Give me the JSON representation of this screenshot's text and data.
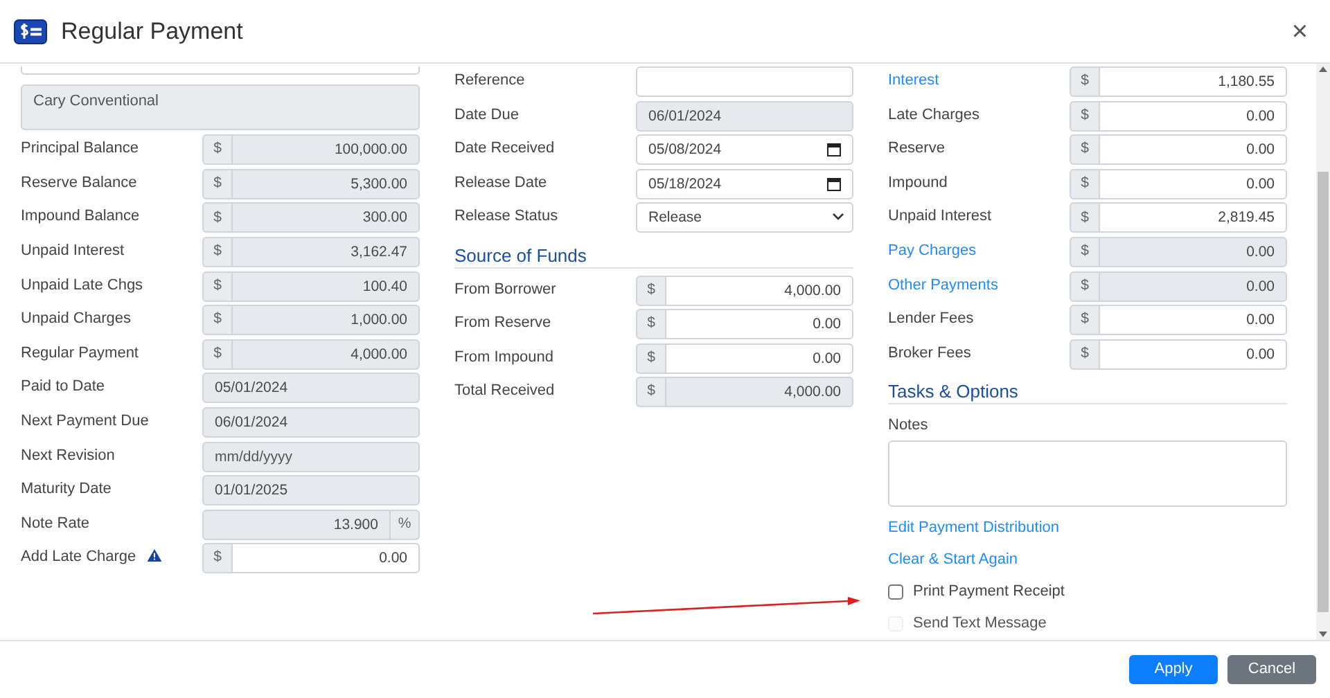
{
  "window": {
    "title": "Regular Payment",
    "close": "×"
  },
  "left": {
    "memo": "Cary Conventional",
    "fields": [
      {
        "label": "Principal Balance",
        "kind": "money",
        "unit": "$",
        "value": "100,000.00",
        "readonly": true
      },
      {
        "label": "Reserve Balance",
        "kind": "money",
        "unit": "$",
        "value": "5,300.00",
        "readonly": true
      },
      {
        "label": "Impound Balance",
        "kind": "money",
        "unit": "$",
        "value": "300.00",
        "readonly": true
      },
      {
        "label": "Unpaid Interest",
        "kind": "money",
        "unit": "$",
        "value": "3,162.47",
        "readonly": true
      },
      {
        "label": "Unpaid Late Chgs",
        "kind": "money",
        "unit": "$",
        "value": "100.40",
        "readonly": true
      },
      {
        "label": "Unpaid Charges",
        "kind": "money",
        "unit": "$",
        "value": "1,000.00",
        "readonly": true
      },
      {
        "label": "Regular Payment",
        "kind": "money",
        "unit": "$",
        "value": "4,000.00",
        "readonly": true
      },
      {
        "label": "Paid to Date",
        "kind": "date",
        "value": "05/01/2024",
        "readonly": true
      },
      {
        "label": "Next Payment Due",
        "kind": "date",
        "value": "06/01/2024",
        "readonly": true
      },
      {
        "label": "Next Revision",
        "kind": "date",
        "placeholder": "mm/dd/yyyy",
        "readonly": true
      },
      {
        "label": "Maturity Date",
        "kind": "date",
        "value": "01/01/2025",
        "readonly": true
      },
      {
        "label": "Note Rate",
        "kind": "percent",
        "unit": "%",
        "value": "13.900",
        "readonly": true
      },
      {
        "label": "Add Late Charge",
        "kind": "money",
        "unit": "$",
        "value": "0.00",
        "readonly": false,
        "warning": true
      }
    ]
  },
  "middle": {
    "fields": [
      {
        "label": "Reference",
        "kind": "text",
        "readonly": false
      },
      {
        "label": "Date Due",
        "kind": "date",
        "value": "06/01/2024",
        "readonly": true
      },
      {
        "label": "Date Received",
        "kind": "date-picker",
        "value": "05/08/2024",
        "readonly": false
      },
      {
        "label": "Release Date",
        "kind": "date-picker",
        "value": "05/18/2024",
        "readonly": false
      },
      {
        "label": "Release Status",
        "kind": "select",
        "value": "Release",
        "readonly": false
      }
    ],
    "section": "Source of Funds",
    "funds": [
      {
        "label": "From Borrower",
        "kind": "money",
        "unit": "$",
        "value": "4,000.00",
        "readonly": false
      },
      {
        "label": "From Reserve",
        "kind": "money",
        "unit": "$",
        "value": "0.00",
        "readonly": false
      },
      {
        "label": "From Impound",
        "kind": "money",
        "unit": "$",
        "value": "0.00",
        "readonly": false
      },
      {
        "label": "Total Received",
        "kind": "money",
        "unit": "$",
        "value": "4,000.00",
        "readonly": true
      }
    ]
  },
  "right": {
    "fields": [
      {
        "label": "Interest",
        "kind": "money",
        "unit": "$",
        "value": "1,180.55",
        "readonly": false,
        "link": true
      },
      {
        "label": "Late Charges",
        "kind": "money",
        "unit": "$",
        "value": "0.00",
        "readonly": false
      },
      {
        "label": "Reserve",
        "kind": "money",
        "unit": "$",
        "value": "0.00",
        "readonly": false
      },
      {
        "label": "Impound",
        "kind": "money",
        "unit": "$",
        "value": "0.00",
        "readonly": false
      },
      {
        "label": "Unpaid Interest",
        "kind": "money",
        "unit": "$",
        "value": "2,819.45",
        "readonly": false
      },
      {
        "label": "Pay Charges",
        "kind": "money",
        "unit": "$",
        "value": "0.00",
        "readonly": true,
        "link": true
      },
      {
        "label": "Other Payments",
        "kind": "money",
        "unit": "$",
        "value": "0.00",
        "readonly": true,
        "link": true
      },
      {
        "label": "Lender Fees",
        "kind": "money",
        "unit": "$",
        "value": "0.00",
        "readonly": false
      },
      {
        "label": "Broker Fees",
        "kind": "money",
        "unit": "$",
        "value": "0.00",
        "readonly": false
      }
    ],
    "section": "Tasks & Options",
    "notes_label": "Notes",
    "links": [
      "Edit Payment Distribution",
      "Clear & Start Again"
    ],
    "options": [
      {
        "label": "Print Payment Receipt",
        "checked": false,
        "disabled": false
      },
      {
        "label": "Send Text Message",
        "checked": false,
        "disabled": true
      }
    ]
  },
  "buttons": [
    {
      "label": "Apply",
      "kind": "primary"
    },
    {
      "label": "Cancel",
      "kind": "secondary"
    }
  ]
}
